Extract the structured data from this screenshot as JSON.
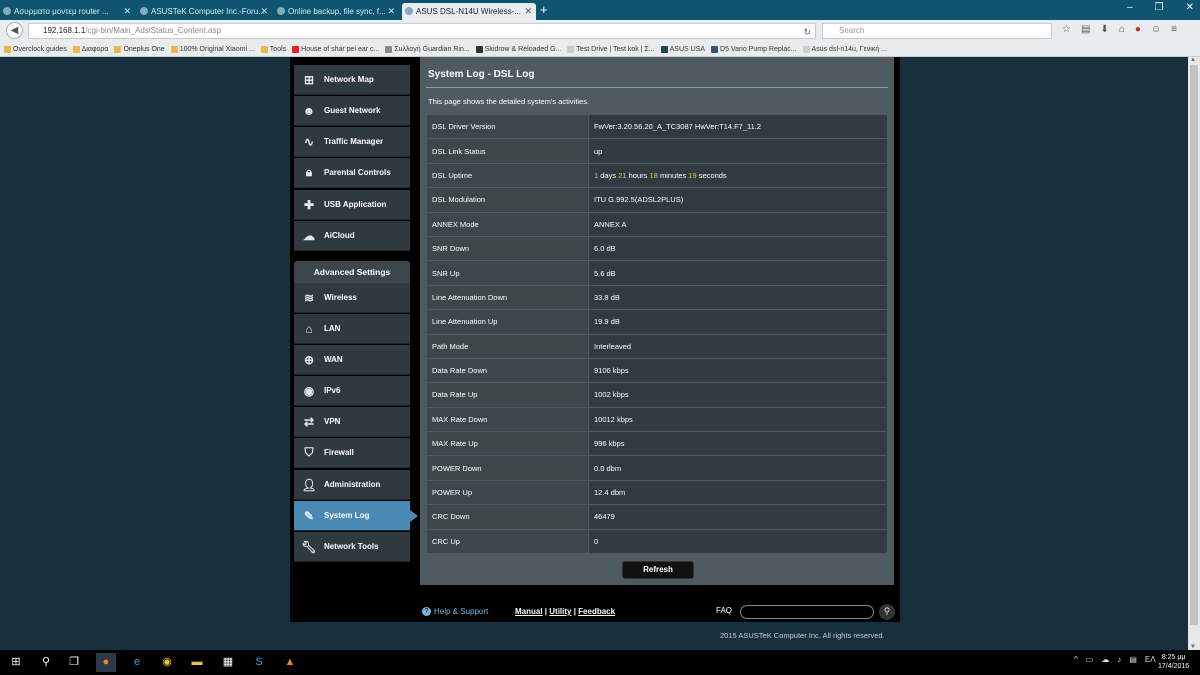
{
  "browser": {
    "tabs": [
      {
        "label": "Ασυρματο μοντεμ router ..."
      },
      {
        "label": "ASUSTeK Computer Inc.-Foru..."
      },
      {
        "label": "Online backup, file sync, f..."
      },
      {
        "label": "ASUS DSL-N14U Wireless-..."
      }
    ],
    "new_tab": "+",
    "url_host": "192.168.1.1",
    "url_path": "/cgi-bin/Main_AdslStatus_Content.asp",
    "search_placeholder": "Search",
    "bookmarks": [
      "Overclock guides",
      "Διαφορα",
      "Oneplus One",
      "100% Original Xiaomi ...",
      "Tools",
      "House of shar pei ear c...",
      "Συλλογή Guardian Rin...",
      "Skidrow & Reloaded G...",
      "Test Drive | Test kok | Σ...",
      "ASUS USA",
      "D5 Vario Pump Replac...",
      "Asus dsl-n14u, Γενική ..."
    ]
  },
  "sidebar": {
    "general_items": [
      {
        "label": "Network Map",
        "icon": "network-map-icon"
      },
      {
        "label": "Guest Network",
        "icon": "guest-network-icon"
      },
      {
        "label": "Traffic Manager",
        "icon": "traffic-manager-icon"
      },
      {
        "label": "Parental Controls",
        "icon": "lock-icon"
      },
      {
        "label": "USB Application",
        "icon": "puzzle-icon"
      },
      {
        "label": "AiCloud",
        "icon": "cloud-icon"
      }
    ],
    "advanced_header": "Advanced Settings",
    "advanced_items": [
      {
        "label": "Wireless",
        "icon": "wifi-icon"
      },
      {
        "label": "LAN",
        "icon": "home-icon"
      },
      {
        "label": "WAN",
        "icon": "globe-icon"
      },
      {
        "label": "IPv6",
        "icon": "ipv6-icon"
      },
      {
        "label": "VPN",
        "icon": "vpn-icon"
      },
      {
        "label": "Firewall",
        "icon": "shield-icon"
      },
      {
        "label": "Administration",
        "icon": "user-icon"
      },
      {
        "label": "System Log",
        "icon": "log-icon",
        "active": true
      },
      {
        "label": "Network Tools",
        "icon": "wrench-icon"
      }
    ]
  },
  "content": {
    "title": "System Log - DSL Log",
    "description": "This page shows the detailed system's activities.",
    "rows": [
      {
        "key": "DSL Driver Version",
        "value": "FwVer:3.20.56.20_A_TC3087 HwVer:T14.F7_11.2"
      },
      {
        "key": "DSL Link Status",
        "value": "up"
      },
      {
        "key": "DSL Uptime",
        "value": ""
      },
      {
        "key": "DSL Modulation",
        "value": "ITU G.992.5(ADSL2PLUS)"
      },
      {
        "key": "ANNEX Mode",
        "value": "ANNEX A"
      },
      {
        "key": "SNR Down",
        "value": "6.0 dB"
      },
      {
        "key": "SNR Up",
        "value": "5.6 dB"
      },
      {
        "key": "Line Attenuation Down",
        "value": "33.8 dB"
      },
      {
        "key": "Line Attenuation Up",
        "value": "19.9 dB"
      },
      {
        "key": "Path Mode",
        "value": "Interleaved"
      },
      {
        "key": "Data Rate Down",
        "value": "9106 kbps"
      },
      {
        "key": "Data Rate Up",
        "value": "1002 kbps"
      },
      {
        "key": "MAX Rate Down",
        "value": "10012 kbps"
      },
      {
        "key": "MAX Rate Up",
        "value": "996 kbps"
      },
      {
        "key": "POWER Down",
        "value": "0.0 dbm"
      },
      {
        "key": "POWER Up",
        "value": "12.4 dbm"
      },
      {
        "key": "CRC Down",
        "value": "46479"
      },
      {
        "key": "CRC Up",
        "value": "0"
      }
    ],
    "uptime": {
      "days": "1",
      "days_unit": "days",
      "hours": "21",
      "hours_unit": "hours",
      "minutes": "18",
      "minutes_unit": "minutes",
      "seconds": "19",
      "seconds_unit": "seconds"
    },
    "refresh_label": "Refresh"
  },
  "footer": {
    "help": "Help & Support",
    "manual": "Manual",
    "utility": "Utility",
    "feedback": "Feedback",
    "faq": "FAQ",
    "copyright": "2015 ASUSTeK Computer Inc. All rights reserved."
  },
  "taskbar": {
    "language": "ΕΛ",
    "time": "8:25 μμ",
    "date": "17/4/2016"
  },
  "colors": {
    "accent": "#4a88b5",
    "highlight": "#f0c33c",
    "panel": "#4e5b61"
  }
}
